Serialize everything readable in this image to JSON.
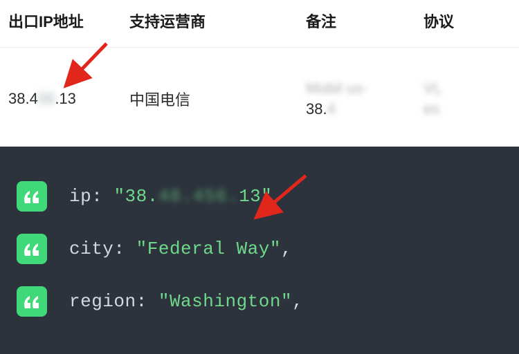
{
  "table": {
    "headers": {
      "ip": "出口IP地址",
      "carrier": "支持运营商",
      "remark": "备注",
      "protocol": "协议"
    },
    "row": {
      "ip_prefix": "38.4",
      "ip_mid_obscured": "  56 ",
      "ip_suffix": ".13",
      "carrier": "中国电信",
      "remark_obscured_top": "Mobil us-",
      "remark_prefix": "38.",
      "remark_obscured_tail": "4",
      "protocol_obscured_top": "VL",
      "protocol_obscured_bottom": "es"
    }
  },
  "code": {
    "lines": [
      {
        "key": "ip",
        "value_prefix": "38.",
        "value_obscured": "48.456.",
        "value_suffix": "13"
      },
      {
        "key": "city",
        "value": "Federal Way"
      },
      {
        "key": "region",
        "value": "Washington"
      }
    ]
  }
}
